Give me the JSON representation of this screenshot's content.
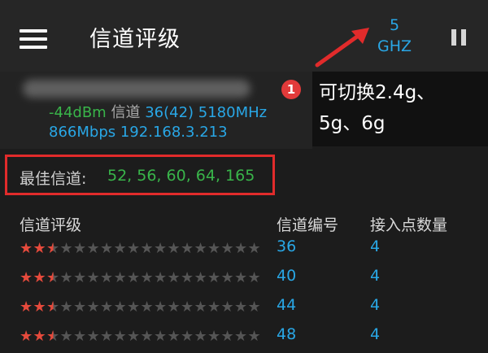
{
  "appbar": {
    "title": "信道评级",
    "band_number": "5",
    "band_unit": "GHZ"
  },
  "network": {
    "signal": "-44dBm",
    "channel_label": "信道",
    "channel_value": "36(42)",
    "frequency": "5180MHz",
    "link_speed": "866Mbps",
    "ip": "192.168.3.213"
  },
  "callout": {
    "badge": "1",
    "line1": "可切换2.4g、",
    "line2": "5g、6g"
  },
  "best": {
    "label": "最佳信道:",
    "values": "52, 56, 60, 64, 165"
  },
  "columns": {
    "rating": "信道评级",
    "channel": "信道编号",
    "count": "接入点数量"
  },
  "rows": [
    {
      "channel": "36",
      "count": "4",
      "stars": 2.5
    },
    {
      "channel": "40",
      "count": "4",
      "stars": 2.5
    },
    {
      "channel": "44",
      "count": "4",
      "stars": 2.5
    },
    {
      "channel": "48",
      "count": "4",
      "stars": 2.5
    }
  ],
  "colors": {
    "accent_blue": "#29a7e6",
    "accent_green": "#39b54a",
    "star_red": "#e64a3c",
    "annotation_red": "#e12b2b"
  }
}
